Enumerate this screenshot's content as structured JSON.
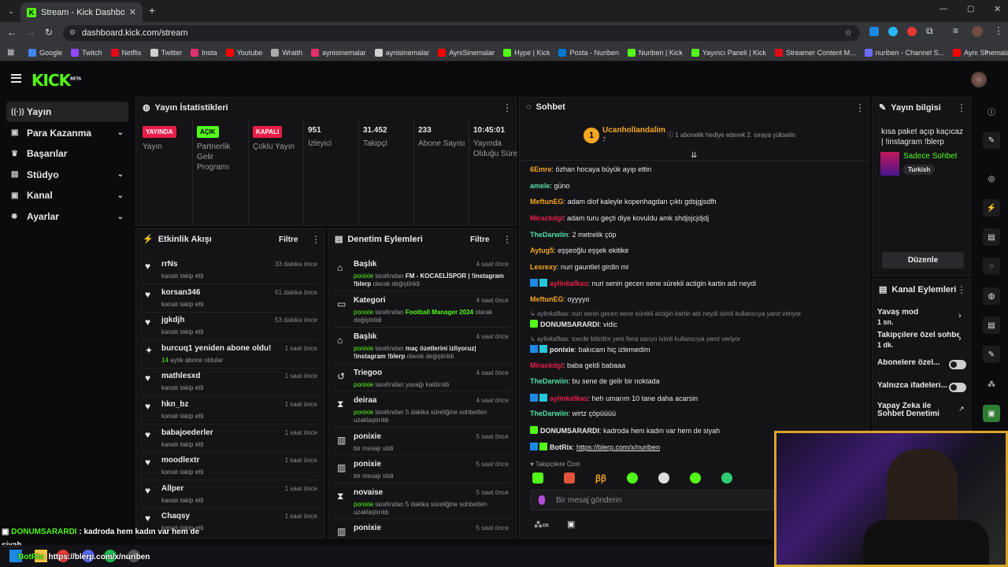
{
  "browser": {
    "tab_title": "Stream - Kick Dashboard",
    "url": "dashboard.kick.com/stream",
    "bookmarks": [
      {
        "label": "Google",
        "color": "#4285f4"
      },
      {
        "label": "Twitch",
        "color": "#9146ff"
      },
      {
        "label": "Netflix",
        "color": "#e50914"
      },
      {
        "label": "Twitter",
        "color": "#cfcfcf"
      },
      {
        "label": "Insta",
        "color": "#e1306c"
      },
      {
        "label": "Youtube",
        "color": "#ff0000"
      },
      {
        "label": "Wraith",
        "color": "#aaaaaa"
      },
      {
        "label": "aynisinemalar",
        "color": "#e1306c"
      },
      {
        "label": "aynisinemalar",
        "color": "#cfcfcf"
      },
      {
        "label": "AyniSinemalar",
        "color": "#ff0000"
      },
      {
        "label": "Hype | Kick",
        "color": "#53fc18"
      },
      {
        "label": "Posta - Nuriben",
        "color": "#0078d4"
      },
      {
        "label": "Nuriben | Kick",
        "color": "#53fc18"
      },
      {
        "label": "Yayıncı Paneli | Kick",
        "color": "#53fc18"
      },
      {
        "label": "Streamer Content M...",
        "color": "#e50914"
      },
      {
        "label": "nuriben - Channel S...",
        "color": "#6b6bff"
      },
      {
        "label": "Aynı Sinemalar - Ça...",
        "color": "#ff0000"
      }
    ]
  },
  "brand": {
    "logo": "KICK",
    "beta": "BETA",
    "accent": "#53fc18"
  },
  "sidebar": {
    "items": [
      {
        "label": "Yayın",
        "icon": "broadcast-icon",
        "active": true
      },
      {
        "label": "Para Kazanma",
        "icon": "money-icon",
        "chevron": true
      },
      {
        "label": "Başarılar",
        "icon": "trophy-icon"
      },
      {
        "label": "Stüdyo",
        "icon": "studio-icon",
        "chevron": true
      },
      {
        "label": "Kanal",
        "icon": "channel-icon",
        "chevron": true
      },
      {
        "label": "Ayarlar",
        "icon": "gear-icon",
        "chevron": true
      }
    ]
  },
  "stats": {
    "title": "Yayın İstatistikleri",
    "items": [
      {
        "badge": "YAYINDA",
        "badge_color": "#e91e4a",
        "label": "Yayın"
      },
      {
        "badge": "AÇIK",
        "badge_color": "#53fc18",
        "label": "Partnerlik Gelir Programı"
      },
      {
        "badge": "KAPALI",
        "badge_color": "#e91e4a",
        "label": "Çoklu Yayın"
      },
      {
        "value": "951",
        "label": "İzleyici"
      },
      {
        "value": "31.452",
        "label": "Takipçi"
      },
      {
        "value": "233",
        "label": "Abone Sayısı"
      },
      {
        "value": "10:45:01",
        "label": "Yayında Olduğu Süre"
      }
    ]
  },
  "activity": {
    "title": "Etkinlik Akışı",
    "filter": "Filtre",
    "items": [
      {
        "name": "rrNs",
        "sub": "kanalı takip etti",
        "time": "33 dakika önce"
      },
      {
        "name": "korsan346",
        "sub": "kanalı takip etti",
        "time": "51 dakika önce"
      },
      {
        "name": "jgkdjh",
        "sub": "kanalı takip etti",
        "time": "53 dakika önce"
      },
      {
        "name": "burcuq1 yeniden abone oldu!",
        "sub_green": "14",
        "sub": "aylık abone oldular",
        "time": "1 saat önce"
      },
      {
        "name": "mathlesxd",
        "sub": "kanalı takip etti",
        "time": "1 saat önce"
      },
      {
        "name": "hkn_bz",
        "sub": "kanalı takip etti",
        "time": "1 saat önce"
      },
      {
        "name": "babajoederler",
        "sub": "kanalı takip etti",
        "time": "1 saat önce"
      },
      {
        "name": "moodlextr",
        "sub": "kanalı takip etti",
        "time": "1 saat önce"
      },
      {
        "name": "Allper",
        "sub": "kanalı takip etti",
        "time": "1 saat önce"
      },
      {
        "name": "Chaqsy",
        "sub": "kanalı takip etti",
        "time": "1 saat önce"
      }
    ]
  },
  "moderation": {
    "title": "Denetim Eylemleri",
    "filter": "Filtre",
    "items": [
      {
        "name": "Başlık",
        "who": "ponixie",
        "pre": " tarafından ",
        "hl": "FM - KOCAELİSPOR | !instagram !blerp",
        "post": " olarak değiştirildi",
        "time": "4 saat önce"
      },
      {
        "name": "Kategori",
        "who": "ponixie",
        "pre": " tarafından ",
        "hl": "Football Manager 2024",
        "post": " olarak değiştirildi",
        "time": "4 saat önce"
      },
      {
        "name": "Başlık",
        "who": "ponixie",
        "pre": " tarafından ",
        "hl": "maç özetlerini izliyoruz| !instagram !blerp",
        "post": " olarak değiştirildi",
        "time": "4 saat önce"
      },
      {
        "name": "Triegoo",
        "who": "ponixie",
        "pre": " tarafından yasağı kaldırıldı",
        "hl": "",
        "post": "",
        "time": "4 saat önce"
      },
      {
        "name": "deiraa",
        "who": "ponixie",
        "pre": " tarafından 5 dakika süreliğine sohbetten uzaklaştırıldı",
        "hl": "",
        "post": "",
        "time": "4 saat önce"
      },
      {
        "name": "ponixie",
        "who": "",
        "pre": "bir mesajı sildi",
        "hl": "",
        "post": "",
        "time": "5 saat önce"
      },
      {
        "name": "ponixie",
        "who": "",
        "pre": "bir mesajı sildi",
        "hl": "",
        "post": "",
        "time": "5 saat önce"
      },
      {
        "name": "novaise",
        "who": "ponixie",
        "pre": " tarafından 5 dakika süreliğine sohbetten uzaklaştırıldı",
        "hl": "",
        "post": "",
        "time": "5 saat önce"
      },
      {
        "name": "ponixie",
        "who": "",
        "pre": "",
        "hl": "",
        "post": "",
        "time": "5 saat önce"
      }
    ]
  },
  "chat": {
    "title": "Sohbet",
    "pinned_user": "Ucanhollandalim",
    "pinned_count": "7",
    "pinned_msg": "1 abonelik hediye ederek 2. sıraya yükselin",
    "messages": [
      {
        "user": "6Emre",
        "color": "#f5a623",
        "text": ": özhan hocaya büyük ayıp ettin"
      },
      {
        "user": "amele",
        "color": "#53e0a0",
        "text": ": güno"
      },
      {
        "user": "MeftunEG",
        "color": "#f5a623",
        "text": ": adam diof kaleyle kopenhagdan çıktı gdsjgjsdfh"
      },
      {
        "user": "Mirackdgl",
        "color": "#e91e4a",
        "text": ": adam turu geçti diye kovuldu amk shdjsjcjdjdj"
      },
      {
        "user": "TheDarwiin",
        "color": "#53e0a0",
        "text": ": 2 metrelik çöp"
      },
      {
        "user": "Aytug5",
        "color": "#f5a623",
        "text": ": eşşeoğlu eşşek ekitike"
      },
      {
        "user": "Lesrexy",
        "color": "#f5a623",
        "text": ": nuri gauntlet girdin mi"
      },
      {
        "user": "aylinkafkas",
        "color": "#e91e4a",
        "text": ": nuri senin gecen sene sürekli actigin kartin adı neydi",
        "badges": true
      },
      {
        "user": "MeftunEG",
        "color": "#f5a623",
        "text": ": oyyyyo"
      },
      {
        "reply": "aylinkafkas: nuri senin gecen sene sürekli actigin kartin adı neydi isimli kullanıcıya yanıt veriyor"
      },
      {
        "user": "DONUMSARARDI",
        "color": "#e9e9ea",
        "text": ": vidic",
        "sub": true
      },
      {
        "reply": "aylinkafkas: icerde bitirdim yeni fena sarıyo isimli kullanıcıya yanıt veriyor"
      },
      {
        "user": "ponixie",
        "color": "#e9e9ea",
        "text": ": bakıcam hiç izlemedim",
        "badges": true
      },
      {
        "user": "Mirackdgl",
        "color": "#e91e4a",
        "text": ": baba geldi babaaa"
      },
      {
        "user": "TheDarwiin",
        "color": "#53e0a0",
        "text": ": bu sene de gelir bir noktada"
      },
      {
        "user": "aylinkafkas",
        "color": "#e91e4a",
        "text": ": heh umarım 10 tane daha acarsin",
        "badges": true
      },
      {
        "user": "TheDarwiin",
        "color": "#53e0a0",
        "text": ": wirtz çöpüüüü"
      },
      {
        "user": "DONUMSARARDI",
        "color": "#e9e9ea",
        "text": ": kadroda hem kadın var hem de siyah",
        "sub": true
      },
      {
        "user": "BotRix",
        "color": "#e9e9ea",
        "text": ": ",
        "link": "https://blerp.com/x/nuriben",
        "badges": true
      }
    ],
    "followers_only": "Takipçilere Özel",
    "input_placeholder": "Bir mesaj gönderin"
  },
  "stream_info": {
    "title": "Yayın bilgisi",
    "stream_title": "kısa paket açıp kaçıcaz | !instagram !blerp",
    "category": "Sadece Sohbet",
    "tag": "Turkish",
    "edit_button": "Düzenle"
  },
  "channel_actions": {
    "title": "Kanal Eylemleri",
    "items": [
      {
        "label": "Yavaş mod",
        "sub": "1 sn.",
        "type": "chevron"
      },
      {
        "label": "Takipçilere özel sohbe",
        "sub": "1 dk.",
        "type": "chevron"
      },
      {
        "label": "Abonelere özel...",
        "type": "toggle"
      },
      {
        "label": "Yalnızca ifadeleri...",
        "type": "toggle"
      },
      {
        "label": "Yapay Zeka ile Sohbet Denetimi",
        "type": "link"
      }
    ]
  },
  "overlay": {
    "line1_user": "DONUMSARARDI",
    "line1_text": " : kadroda hem kadın var hem de",
    "line1_cont": "siyah",
    "line2_user": "BotRix",
    "line2_text": ": https://blerp.com/x/nuriben"
  }
}
